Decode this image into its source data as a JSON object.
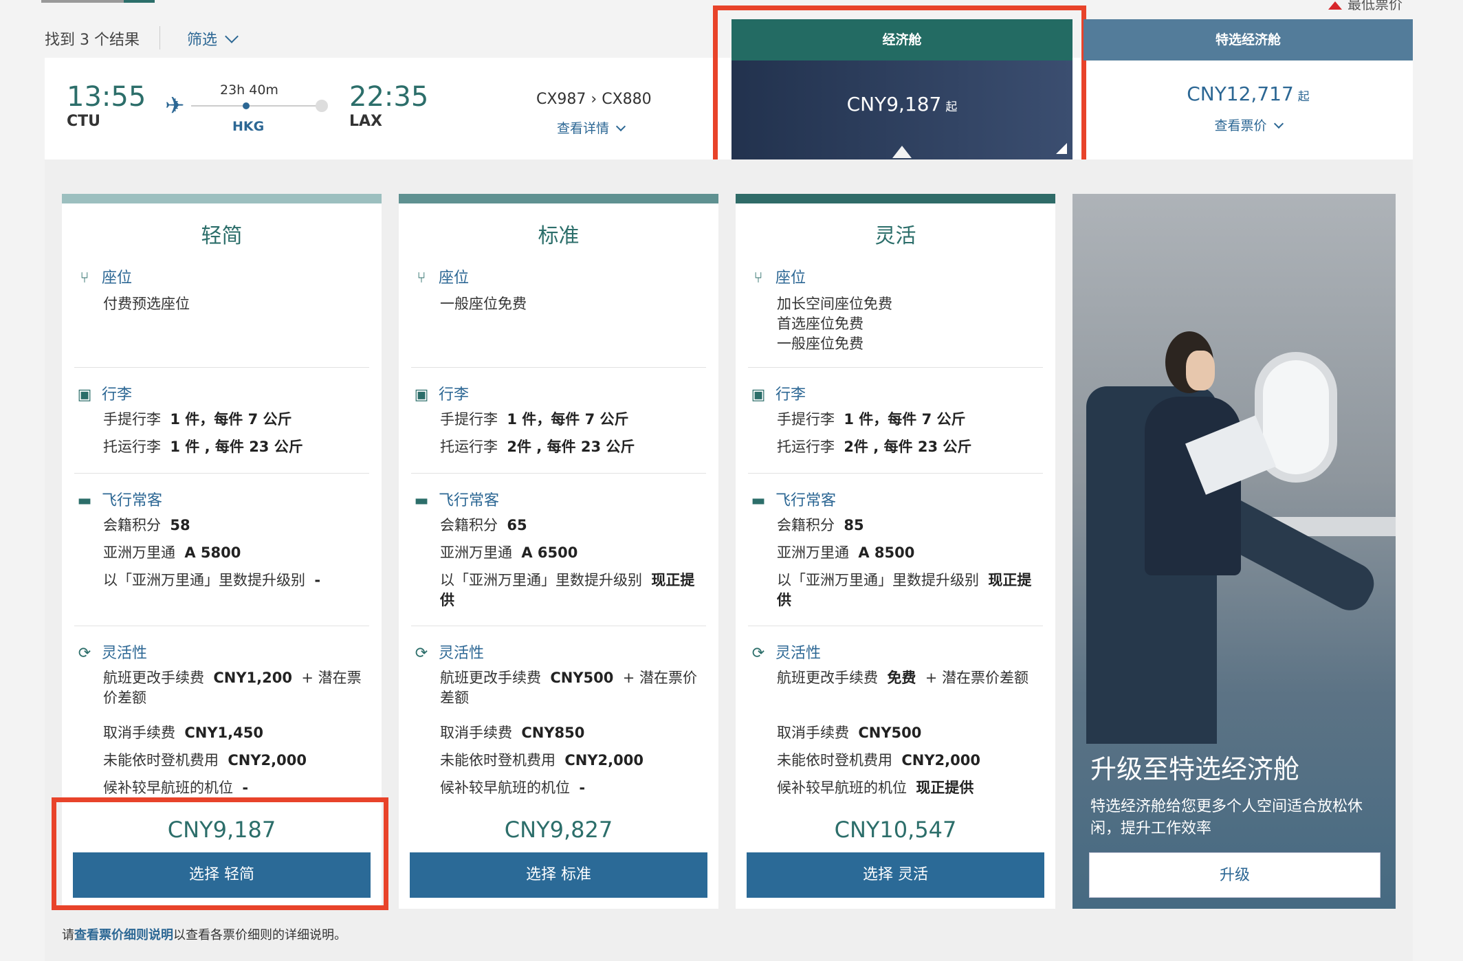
{
  "header": {
    "lowest_fare_label": "最低票价",
    "results_text": "找到 3 个结果",
    "filter_label": "筛选"
  },
  "flight": {
    "dep_time": "13:55",
    "dep_code": "CTU",
    "arr_time": "22:35",
    "arr_code": "LAX",
    "duration": "23h 40m",
    "stop": "HKG",
    "flight_numbers": "CX987 › CX880",
    "details_link": "查看详情"
  },
  "cabins": {
    "economy": {
      "label": "经济舱",
      "price": "CNY9,187",
      "suffix": "起"
    },
    "premium": {
      "label": "特选经济舱",
      "price": "CNY12,717",
      "suffix": "起",
      "link": "查看票价"
    }
  },
  "fares": [
    {
      "name": "轻简",
      "color": "#9cbfbf",
      "seat_head": "座位",
      "seat_lines": [
        "付费预选座位"
      ],
      "bag_head": "行李",
      "carry_on": "手提行李",
      "carry_on_val": "1 件，每件 7 公斤",
      "checked": "托运行李",
      "checked_val": "1 件 , 每件 23 公斤",
      "ff_head": "飞行常客",
      "club_points": "会籍积分",
      "club_points_val": "58",
      "asia_miles": "亚洲万里通",
      "asia_miles_val": "A 5800",
      "upgrade": "以「亚洲万里通」里数提升级别",
      "upgrade_val": "-",
      "flex_head": "灵活性",
      "change_fee": "航班更改手续费",
      "change_fee_val": "CNY1,200",
      "change_fee_tail": "+ 潜在票价差额",
      "cancel_fee": "取消手续费",
      "cancel_fee_val": "CNY1,450",
      "noshow": "未能依时登机费用",
      "noshow_val": "CNY2,000",
      "standby": "候补较早航班的机位",
      "standby_val": "-",
      "price": "CNY9,187",
      "button": "选择 轻简"
    },
    {
      "name": "标准",
      "color": "#5f9191",
      "seat_head": "座位",
      "seat_lines": [
        "一般座位免费"
      ],
      "bag_head": "行李",
      "carry_on": "手提行李",
      "carry_on_val": "1 件，每件 7 公斤",
      "checked": "托运行李",
      "checked_val": "2件 , 每件 23 公斤",
      "ff_head": "飞行常客",
      "club_points": "会籍积分",
      "club_points_val": "65",
      "asia_miles": "亚洲万里通",
      "asia_miles_val": "A 6500",
      "upgrade": "以「亚洲万里通」里数提升级别",
      "upgrade_val": "现正提供",
      "flex_head": "灵活性",
      "change_fee": "航班更改手续费",
      "change_fee_val": "CNY500",
      "change_fee_tail": "+ 潜在票价差额",
      "cancel_fee": "取消手续费",
      "cancel_fee_val": "CNY850",
      "noshow": "未能依时登机费用",
      "noshow_val": "CNY2,000",
      "standby": "候补较早航班的机位",
      "standby_val": "-",
      "price": "CNY9,827",
      "button": "选择 标准"
    },
    {
      "name": "灵活",
      "color": "#2f6b68",
      "seat_head": "座位",
      "seat_lines": [
        "加长空间座位免费",
        "首选座位免费",
        "一般座位免费"
      ],
      "bag_head": "行李",
      "carry_on": "手提行李",
      "carry_on_val": "1 件，每件 7 公斤",
      "checked": "托运行李",
      "checked_val": "2件 , 每件 23 公斤",
      "ff_head": "飞行常客",
      "club_points": "会籍积分",
      "club_points_val": "85",
      "asia_miles": "亚洲万里通",
      "asia_miles_val": "A 8500",
      "upgrade": "以「亚洲万里通」里数提升级别",
      "upgrade_val": "现正提供",
      "flex_head": "灵活性",
      "change_fee": "航班更改手续费",
      "change_fee_val": "免费",
      "change_fee_tail": "+ 潜在票价差额",
      "cancel_fee": "取消手续费",
      "cancel_fee_val": "CNY500",
      "noshow": "未能依时登机费用",
      "noshow_val": "CNY2,000",
      "standby": "候补较早航班的机位",
      "standby_val": "现正提供",
      "price": "CNY10,547",
      "button": "选择 灵活"
    }
  ],
  "upgrade": {
    "title": "升级至特选经济舱",
    "desc": "特选经济舱给您更多个人空间适合放松休闲，提升工作效率",
    "button": "升级"
  },
  "footnote": {
    "prefix": "请",
    "link": "查看票价细则说明",
    "suffix": "以查看各票价细则的详细说明。"
  },
  "colors": {
    "teal": "#2c6e6a",
    "blue": "#2b6a97",
    "highlight": "#e8432a"
  }
}
